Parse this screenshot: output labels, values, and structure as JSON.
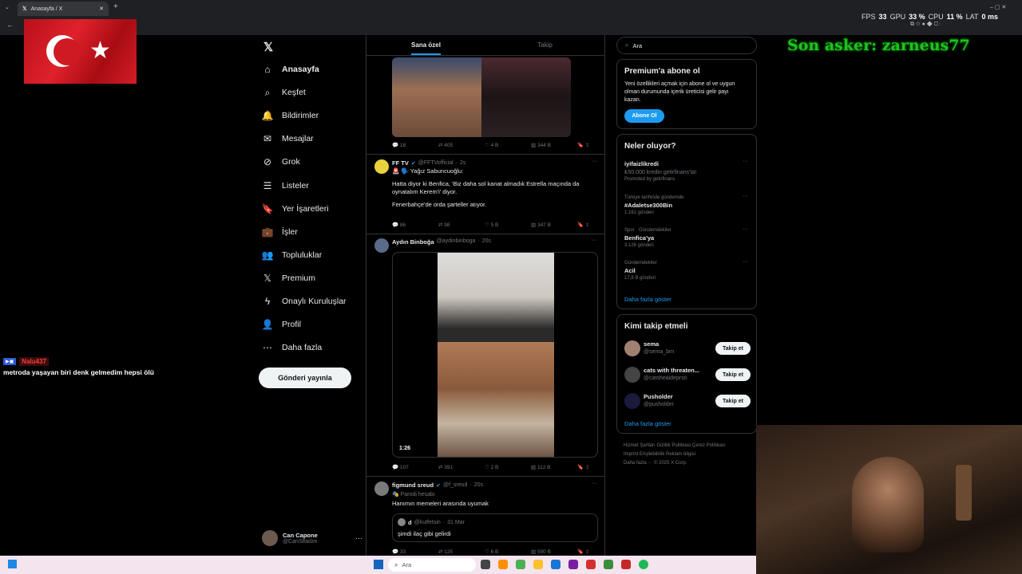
{
  "browser": {
    "tab_title": "Anasayfa / X",
    "new_tab": "+"
  },
  "perf": {
    "fps_label": "FPS",
    "fps": "33",
    "gpu_label": "GPU",
    "gpu": "33 %",
    "cpu_label": "CPU",
    "cpu": "11 %",
    "lat_label": "LAT",
    "lat": "0 ms"
  },
  "overlay": {
    "text": "Son asker: zarneus77"
  },
  "chat": {
    "user": "Nalu437",
    "message": "metroda yaşayan biri denk gelmedim hepsi ölü"
  },
  "sidebar": {
    "items": [
      {
        "label": "Anasayfa",
        "icon": "home-icon"
      },
      {
        "label": "Keşfet",
        "icon": "search-icon"
      },
      {
        "label": "Bildirimler",
        "icon": "bell-icon"
      },
      {
        "label": "Mesajlar",
        "icon": "mail-icon"
      },
      {
        "label": "Grok",
        "icon": "grok-icon"
      },
      {
        "label": "Listeler",
        "icon": "list-icon"
      },
      {
        "label": "Yer İşaretleri",
        "icon": "bookmark-icon"
      },
      {
        "label": "İşler",
        "icon": "briefcase-icon"
      },
      {
        "label": "Topluluklar",
        "icon": "people-icon"
      },
      {
        "label": "Premium",
        "icon": "x-icon"
      },
      {
        "label": "Onaylı Kuruluşlar",
        "icon": "lightning-icon"
      },
      {
        "label": "Profil",
        "icon": "person-icon"
      },
      {
        "label": "Daha fazla",
        "icon": "more-circle-icon"
      }
    ],
    "post_button": "Gönderi yayınla",
    "profile_name": "Can Capone",
    "profile_handle": "@CanSlfadze"
  },
  "feed": {
    "tabs": [
      "Sana özel",
      "Takip"
    ],
    "tweet1_stats": {
      "replies": "18",
      "reposts": "405",
      "likes": "4 B",
      "views": "344 B"
    },
    "tweet2": {
      "name": "FF TV",
      "handle": "@FFTVofficial",
      "time": "2s",
      "line1": "🚨 🗣️ Yağız Sabuncuoğlu:",
      "line2": "Hatta diyor ki Benfica, 'Biz daha sol kanat almadık Estrella maçında da",
      "line3": "oynatalım Kerem'i' diyor.",
      "line4": "Fenerbahçe'de orda şarteller atıyor.",
      "replies": "86",
      "reposts": "98",
      "likes": "5 B",
      "views": "347 B"
    },
    "tweet3": {
      "name": "Aydın Binboğa",
      "handle": "@aydinbinboga",
      "time": "20s",
      "duration": "1:26",
      "replies": "107",
      "reposts": "391",
      "likes": "2 B",
      "views": "112 B"
    },
    "tweet4": {
      "name": "figmund sreud",
      "handle": "@f_sreud",
      "time": "20s",
      "badge": "Parodi hesabı",
      "text": "Hanımın memeleri arasında uyumak",
      "quote_name": "d",
      "quote_handle": "@kutfetsin",
      "quote_time": "31 Mar",
      "quote_text": "şimdi ilaç gibi gelirdi",
      "replies": "33",
      "reposts": "125",
      "likes": "6 B",
      "views": "500 B"
    }
  },
  "right": {
    "search_placeholder": "Ara",
    "premium_title": "Premium'a abone ol",
    "premium_text1": "Yeni özellikleri açmak için abone ol ve uygun",
    "premium_text2": "olman durumunda içerik üreticisi gelir payı",
    "premium_text3": "kazan.",
    "premium_button": "Abone Ol",
    "trends_title": "Neler oluyor?",
    "promo_name": "iyifaizlikredi",
    "promo_text": "₺50.000 kredin getirfinans'ta!",
    "promo_tag": "Promoted by getirfinans",
    "trends": [
      {
        "cat": "Türkiye tarihinde gündemde",
        "name": "#Adaletse300Bin",
        "count": "1.161 gönderi"
      },
      {
        "cat": "Spor · Gündemdekiler",
        "name": "Benfica'ya",
        "count": "3.126 gönderi"
      },
      {
        "cat": "Gündemdekiler",
        "name": "Acil",
        "count": "17,8 B gönderi"
      }
    ],
    "show_more": "Daha fazla göster",
    "who_title": "Kimi takip etmeli",
    "who": [
      {
        "name": "sema",
        "handle": "@sema_brn"
      },
      {
        "name": "cats with threaten...",
        "handle": "@catsheaideprsn"
      },
      {
        "name": "Pusholder",
        "handle": "@pusholder"
      }
    ],
    "follow_label": "Takip et",
    "footer1": "Hizmet Şartları   Gizlilik Politikası   Çerez Politikası",
    "footer2": "Imprint   Erişilebilirlik   Reklam bilgisi",
    "footer3": "Daha fazla ···   © 2025 X Corp."
  },
  "taskbar": {
    "search": "Ara"
  }
}
